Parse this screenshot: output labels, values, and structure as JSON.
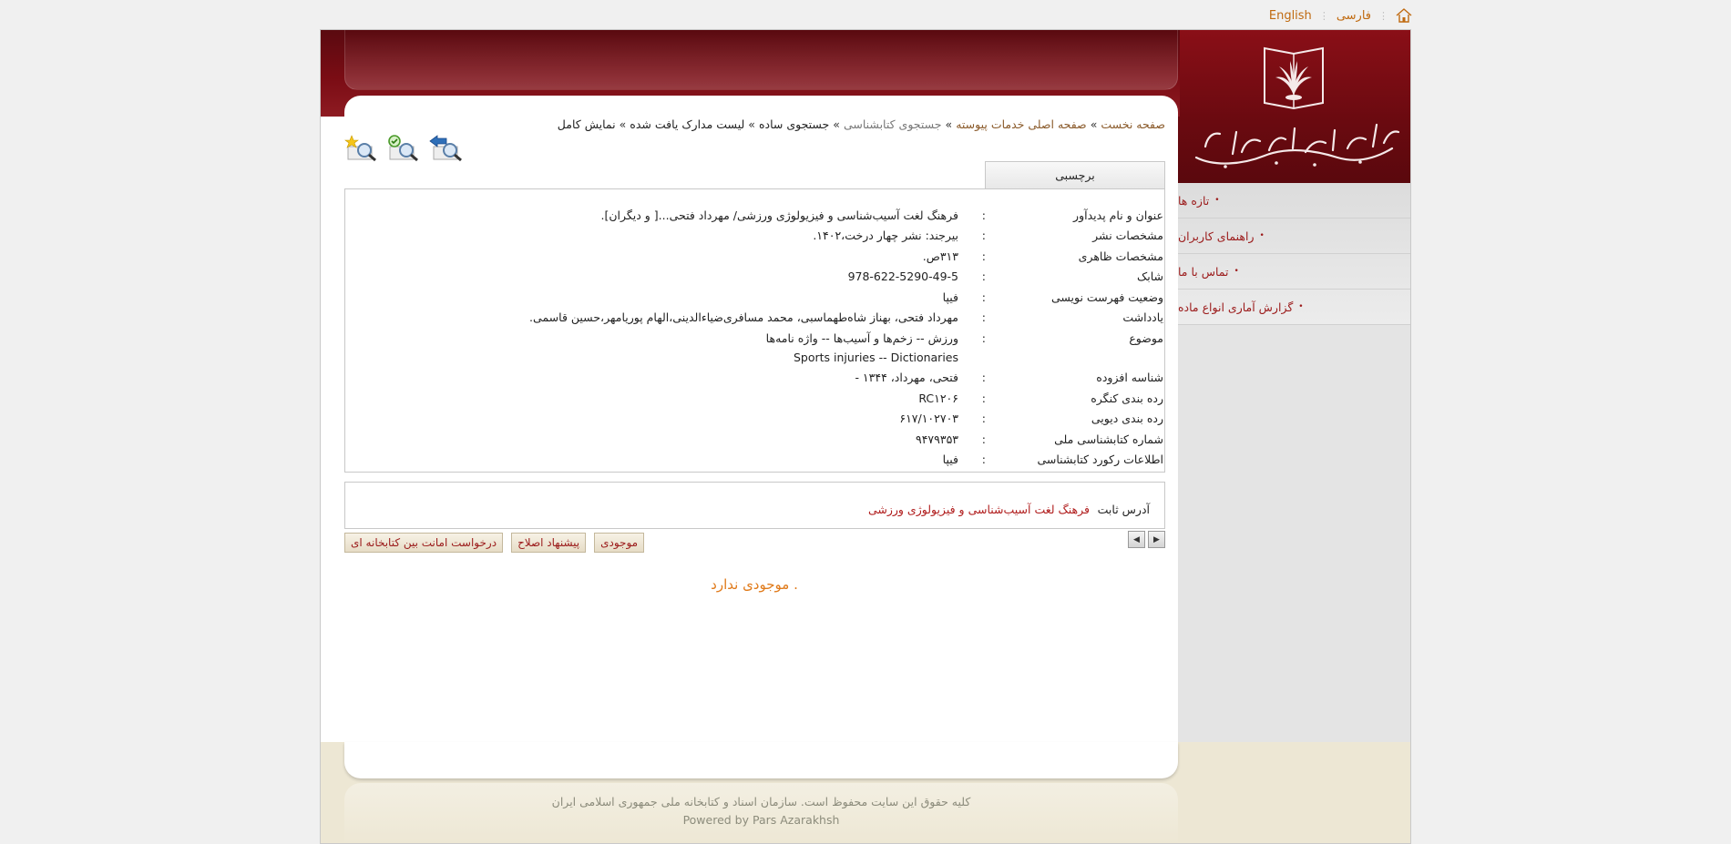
{
  "langbar": {
    "persian": "فارسی",
    "english": "English"
  },
  "menu": {
    "items": [
      {
        "label": "تازه ها"
      },
      {
        "label": "راهنمای کاربران"
      },
      {
        "label": "تماس با ما"
      },
      {
        "label": "گزارش آماری انواع ماده"
      }
    ]
  },
  "breadcrumb": {
    "home": "صفحه نخست",
    "services": "صفحه اصلی خدمات پیوسته",
    "catalog_search": "جستجوی کتابشناسی",
    "simple_search": "جستجوی ساده",
    "results": "لیست مدارک یافت شده",
    "current": "نمایش کامل"
  },
  "tab": {
    "label": "برچسبی"
  },
  "record": [
    {
      "label": "عنوان و نام پدیدآور",
      "value": "فرهنگ لغت آسیب‌شناسی و فیزیولوژی ورزشی/ مهرداد فتحی...[ و دیگران]."
    },
    {
      "label": "مشخصات نشر",
      "value": "بیرجند: نشر چهار درخت،۱۴۰۲."
    },
    {
      "label": "مشخصات ظاهری",
      "value": "۳۱۳ص."
    },
    {
      "label": "شابک",
      "value": "978-622-5290-49-5"
    },
    {
      "label": "وضعیت فهرست نویسی",
      "value": "فیپا"
    },
    {
      "label": "يادداشت",
      "value": "مهرداد فتحی، بهناز شاه‌طهماسبی، محمد مسافری‌ضیاءالدینی،الهام پوریامهر،حسین قاسمی."
    },
    {
      "label": "موضوع",
      "value": "ورزش -- زخم‌ها و آسیب‌ها -- واژه نامه‌ها",
      "value2": "Sports injuries -- Dictionaries"
    },
    {
      "label": "شناسه افزوده",
      "value": "فتحی، مهرداد، ۱۳۴۴ -"
    },
    {
      "label": "رده بندی کنگره",
      "value": "RC۱۲۰۶"
    },
    {
      "label": "رده بندی دیویی",
      "value": "۶۱۷/۱۰۲۷۰۳"
    },
    {
      "label": "شماره کتابشناسی ملی",
      "value": "۹۴۷۹۳۵۳"
    },
    {
      "label": "اطلاعات رکورد کتابشناسی",
      "value": "فیپا"
    }
  ],
  "permalink": {
    "label": "آدرس ثابت",
    "link": "فرهنگ لغت آسیب‌شناسی و فیزیولوژی ورزشی"
  },
  "actions": {
    "ill_request": "درخواست امانت بین کتابخانه ای",
    "suggest_fix": "پیشنهاد اصلاح",
    "availability": "موجودی"
  },
  "notice": "موجودی ندارد .",
  "footer": {
    "copyright": "کلیه حقوق این سایت محفوظ است. سازمان اسناد و کتابخانه ملی جمهوری اسلامی ایران",
    "powered": "Powered by Pars Azarakhsh"
  },
  "colors": {
    "brand_dark_red": "#6a0a10",
    "link_red": "#9b1a1a",
    "accent_orange": "#e07a1a",
    "footer_beige": "#ede7d4"
  },
  "icons": {
    "home": "home-icon",
    "new_search": "new-search-icon",
    "refine_search": "refine-search-icon",
    "back_search": "back-to-search-icon",
    "logo": "national-library-logo-icon"
  }
}
